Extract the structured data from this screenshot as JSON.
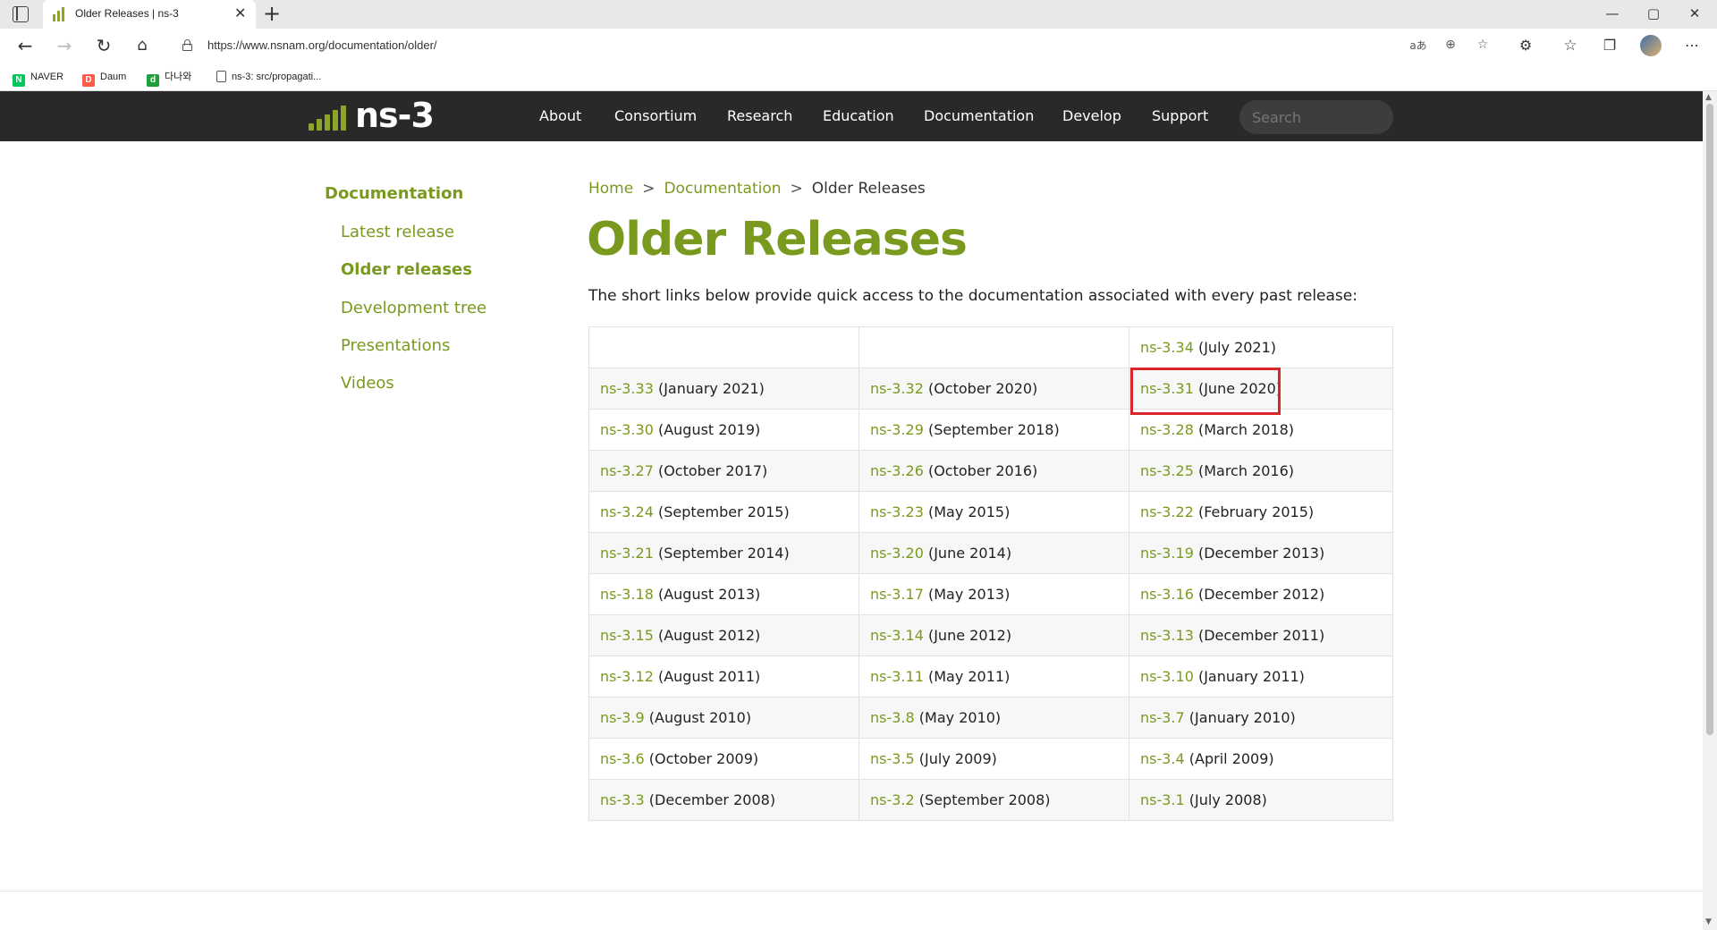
{
  "browser": {
    "tab_title": "Older Releases | ns-3",
    "tab_close": "✕",
    "new_tab": "+",
    "url": "https://www.nsnam.org/documentation/older/",
    "window_controls": [
      "—",
      "▢",
      "✕"
    ],
    "url_icons": [
      "read-aloud-icon",
      "zoom-icon",
      "favorite-add-icon"
    ],
    "toolbar_icons": [
      "extensions-icon",
      "favorites-icon",
      "collections-icon",
      "profile-avatar",
      "more-menu-icon"
    ]
  },
  "bookmarks": [
    {
      "label": "NAVER",
      "icon": "N",
      "color": "#03c75a"
    },
    {
      "label": "Daum",
      "icon": "D",
      "color": "#ff5a4a"
    },
    {
      "label": "다나와",
      "icon": "d",
      "color": "#1ca13b"
    },
    {
      "label": "ns-3: src/propagati...",
      "icon": "page",
      "color": "#ffffff"
    }
  ],
  "site": {
    "logo": "ns-3",
    "menu": [
      "About",
      "Consortium",
      "Research",
      "Education",
      "Documentation",
      "Develop",
      "Support"
    ],
    "search_placeholder": "Search",
    "accent_color": "#7a9a1f"
  },
  "sidebar": {
    "title": "Documentation",
    "items": [
      {
        "label": "Latest release",
        "active": false
      },
      {
        "label": "Older releases",
        "active": true
      },
      {
        "label": "Development tree",
        "active": false
      },
      {
        "label": "Presentations",
        "active": false
      },
      {
        "label": "Videos",
        "active": false
      }
    ]
  },
  "breadcrumb": {
    "home": "Home",
    "sep": ">",
    "documentation": "Documentation",
    "current": "Older Releases"
  },
  "page": {
    "title": "Older Releases",
    "intro": "The short links below provide quick access to the documentation associated with every past release:"
  },
  "releases": [
    [
      null,
      null,
      {
        "version": "ns-3.34",
        "date": "(July 2021)"
      }
    ],
    [
      {
        "version": "ns-3.33",
        "date": "(January 2021)"
      },
      {
        "version": "ns-3.32",
        "date": "(October 2020)"
      },
      {
        "version": "ns-3.31",
        "date": "(June 2020)"
      }
    ],
    [
      {
        "version": "ns-3.30",
        "date": "(August 2019)"
      },
      {
        "version": "ns-3.29",
        "date": "(September 2018)"
      },
      {
        "version": "ns-3.28",
        "date": "(March 2018)"
      }
    ],
    [
      {
        "version": "ns-3.27",
        "date": "(October 2017)"
      },
      {
        "version": "ns-3.26",
        "date": "(October 2016)"
      },
      {
        "version": "ns-3.25",
        "date": "(March 2016)"
      }
    ],
    [
      {
        "version": "ns-3.24",
        "date": "(September 2015)"
      },
      {
        "version": "ns-3.23",
        "date": "(May 2015)"
      },
      {
        "version": "ns-3.22",
        "date": "(February 2015)"
      }
    ],
    [
      {
        "version": "ns-3.21",
        "date": "(September 2014)"
      },
      {
        "version": "ns-3.20",
        "date": "(June 2014)"
      },
      {
        "version": "ns-3.19",
        "date": "(December 2013)"
      }
    ],
    [
      {
        "version": "ns-3.18",
        "date": "(August 2013)"
      },
      {
        "version": "ns-3.17",
        "date": "(May 2013)"
      },
      {
        "version": "ns-3.16",
        "date": "(December 2012)"
      }
    ],
    [
      {
        "version": "ns-3.15",
        "date": "(August 2012)"
      },
      {
        "version": "ns-3.14",
        "date": "(June 2012)"
      },
      {
        "version": "ns-3.13",
        "date": "(December 2011)"
      }
    ],
    [
      {
        "version": "ns-3.12",
        "date": "(August 2011)"
      },
      {
        "version": "ns-3.11",
        "date": "(May 2011)"
      },
      {
        "version": "ns-3.10",
        "date": "(January 2011)"
      }
    ],
    [
      {
        "version": "ns-3.9",
        "date": "(August 2010)"
      },
      {
        "version": "ns-3.8",
        "date": "(May 2010)"
      },
      {
        "version": "ns-3.7",
        "date": "(January 2010)"
      }
    ],
    [
      {
        "version": "ns-3.6",
        "date": "(October 2009)"
      },
      {
        "version": "ns-3.5",
        "date": "(July 2009)"
      },
      {
        "version": "ns-3.4",
        "date": "(April 2009)"
      }
    ],
    [
      {
        "version": "ns-3.3",
        "date": "(December 2008)"
      },
      {
        "version": "ns-3.2",
        "date": "(September 2008)"
      },
      {
        "version": "ns-3.1",
        "date": "(July 2008)"
      }
    ]
  ],
  "highlight_color": "#d9262b"
}
